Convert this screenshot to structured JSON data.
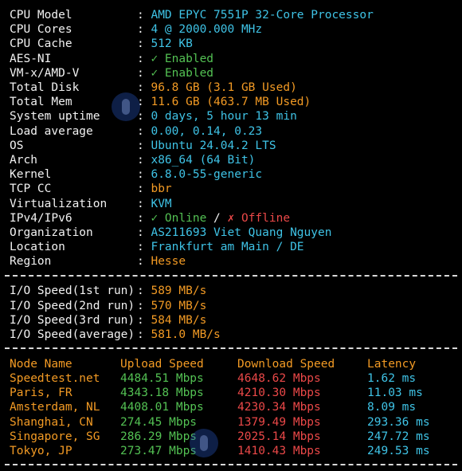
{
  "system_info": [
    {
      "label": "CPU Model",
      "value": "AMD EPYC 7551P 32-Core Processor",
      "color": "cyan"
    },
    {
      "label": "CPU Cores",
      "value": "4 @ 2000.000 MHz",
      "color": "cyan"
    },
    {
      "label": "CPU Cache",
      "value": "512 KB",
      "color": "cyan"
    },
    {
      "label": "AES-NI",
      "value": "✓ Enabled",
      "color": "green"
    },
    {
      "label": "VM-x/AMD-V",
      "value": "✓ Enabled",
      "color": "green"
    },
    {
      "label": "Total Disk",
      "value": "96.8 GB (3.1 GB Used)",
      "color": "orange"
    },
    {
      "label": "Total Mem",
      "value": "11.6 GB (463.7 MB Used)",
      "color": "orange"
    },
    {
      "label": "System uptime",
      "value": "0 days, 5 hour 13 min",
      "color": "cyan"
    },
    {
      "label": "Load average",
      "value": "0.00, 0.14, 0.23",
      "color": "cyan"
    },
    {
      "label": "OS",
      "value": "Ubuntu 24.04.2 LTS",
      "color": "cyan"
    },
    {
      "label": "Arch",
      "value": "x86_64 (64 Bit)",
      "color": "cyan"
    },
    {
      "label": "Kernel",
      "value": "6.8.0-55-generic",
      "color": "cyan"
    },
    {
      "label": "TCP CC",
      "value": "bbr",
      "color": "orange"
    },
    {
      "label": "Virtualization",
      "value": "KVM",
      "color": "cyan"
    },
    {
      "label": "Organization",
      "value": "AS211693 Viet Quang Nguyen",
      "color": "cyan"
    },
    {
      "label": "Location",
      "value": "Frankfurt am Main / DE",
      "color": "cyan"
    },
    {
      "label": "Region",
      "value": "Hesse",
      "color": "orange"
    }
  ],
  "ip": {
    "label": "IPv4/IPv6",
    "online": "✓ Online",
    "slash": " / ",
    "offline": "✗ Offline"
  },
  "separator": ": ",
  "io_speed": [
    {
      "label": "I/O Speed(1st run)",
      "value": "589 MB/s"
    },
    {
      "label": "I/O Speed(2nd run)",
      "value": "570 MB/s"
    },
    {
      "label": "I/O Speed(3rd run)",
      "value": "584 MB/s"
    },
    {
      "label": "I/O Speed(average)",
      "value": "581.0 MB/s"
    }
  ],
  "speedtest": {
    "headers": {
      "node": "Node Name",
      "upload": "Upload Speed",
      "download": "Download Speed",
      "latency": "Latency"
    },
    "rows": [
      {
        "node": "Speedtest.net",
        "upload": "4484.51 Mbps",
        "download": "4648.62 Mbps",
        "latency": "1.62 ms"
      },
      {
        "node": "Paris, FR",
        "upload": "4343.18 Mbps",
        "download": "4210.30 Mbps",
        "latency": "11.03 ms"
      },
      {
        "node": "Amsterdam, NL",
        "upload": "4408.01 Mbps",
        "download": "4230.34 Mbps",
        "latency": "8.09 ms"
      },
      {
        "node": "Shanghai, CN",
        "upload": "274.45 Mbps",
        "download": "1379.49 Mbps",
        "latency": "293.36 ms"
      },
      {
        "node": "Singapore, SG",
        "upload": "286.29 Mbps",
        "download": "2025.14 Mbps",
        "latency": "247.72 ms"
      },
      {
        "node": "Tokyo, JP",
        "upload": "273.47 Mbps",
        "download": "1410.43 Mbps",
        "latency": "249.53 ms"
      }
    ]
  },
  "colors": {
    "background": "#000000",
    "label": "#f2f2f2",
    "cyan": "#3fc3e6",
    "green": "#53c153",
    "orange": "#f29a24",
    "red": "#ea4848"
  }
}
